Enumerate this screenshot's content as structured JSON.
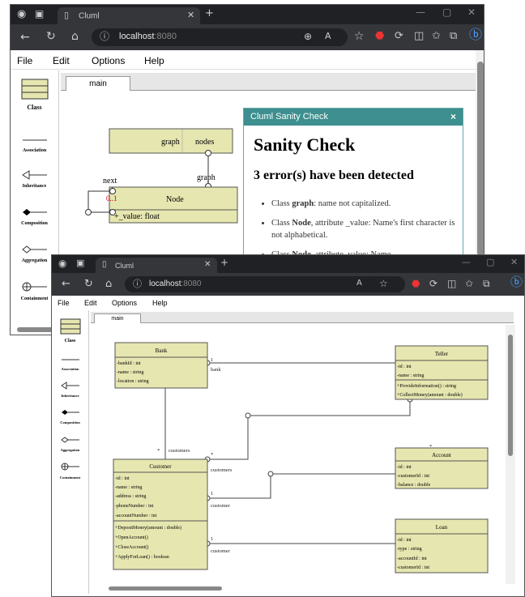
{
  "browser": {
    "tab_title": "Cluml",
    "url_host": "localhost",
    "url_port": ":8080"
  },
  "menu": [
    "File",
    "Edit",
    "Options",
    "Help"
  ],
  "palette": {
    "items": [
      "Class",
      "Association",
      "Inheritance",
      "Composition",
      "Aggregation",
      "Containment"
    ]
  },
  "diagram_tab": "main",
  "back_diagram": {
    "graph_class": "graph",
    "nodes_label": "nodes",
    "graph_label": "graph",
    "next_label": "next",
    "mult_0_1": "0..1",
    "mult_1": "1",
    "node_class": "Node",
    "node_attr": "+_value:  float"
  },
  "sanity": {
    "header": "Cluml Sanity Check",
    "close": "×",
    "title": "Sanity Check",
    "subtitle": "3 error(s) have been detected",
    "errors": [
      {
        "prefix": "Class ",
        "bold": "graph",
        "rest": ": name not capitalized."
      },
      {
        "prefix": "Class ",
        "bold": "Node",
        "rest": ", attribute _value: Name's first character is not alphabetical."
      },
      {
        "prefix": "Class ",
        "bold": "Node",
        "rest": ", attribute_value: Name"
      }
    ]
  },
  "front_diagram": {
    "classes": {
      "bank": {
        "name": "Bank",
        "attrs": [
          "-bankId : int",
          "-name : string",
          "-location : string"
        ]
      },
      "teller": {
        "name": "Teller",
        "attrs": [
          "-id : int",
          "-name : string"
        ],
        "ops": [
          "+ProvideInformation() : string",
          "+CollectMoney(amount : double)"
        ]
      },
      "customer": {
        "name": "Customer",
        "attrs": [
          "-id : int",
          "-name : string",
          "-address : string",
          "-phoneNumber : int",
          "-accountNumber : int"
        ],
        "ops": [
          "+DepositMoney(amount : double)",
          "+OpenAccount()",
          "+CloseAccount()",
          "+ApplyForLoan() : boolean"
        ]
      },
      "account": {
        "name": "Account",
        "attrs": [
          "-id : int",
          "-customerId : int",
          "-balance : double"
        ]
      },
      "loan": {
        "name": "Loan",
        "attrs": [
          "-id : int",
          "-type : string",
          "-accountId : int",
          "-customerId : int"
        ]
      }
    },
    "labels": {
      "bank_teller_1": "1",
      "bank_teller_star": "*",
      "bank_role": "bank",
      "employees": "employees",
      "bank_cust_1": "1",
      "bank_role2": "bank",
      "customers_top": "customers",
      "cust_star": "*",
      "tellers": "tellers",
      "teller_star": "*",
      "customers_1": "customers",
      "star_1": "*",
      "accounts": "accounts",
      "acct_star": "*",
      "one_2": "1",
      "customer_2": "customer",
      "one_3": "1",
      "customer_3": "customer",
      "loans": "loans",
      "loan_star": "*"
    }
  },
  "colors": {
    "class_fill": "#e6e6b0",
    "class_stroke": "#555555",
    "dialog_header": "#3e8f8f",
    "browser_chrome": "#202124",
    "mult_red": "#cc0000"
  }
}
